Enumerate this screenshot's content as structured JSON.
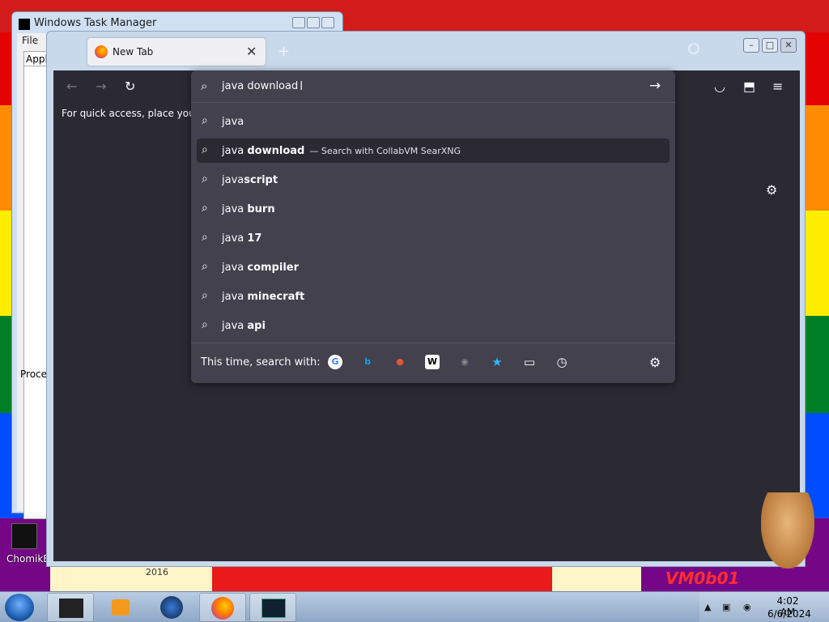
{
  "desktop": {
    "icon_label_chomik": "ChomikB",
    "year_badge": "2016",
    "vm_label": "VM0b01"
  },
  "task_manager": {
    "title": "Windows Task Manager",
    "menu_file": "File",
    "tab_applications": "Applic",
    "tab_processes": "Proces"
  },
  "browser": {
    "tab_title": "New Tab",
    "tab_close": "✕",
    "new_tab": "+",
    "bookmark_message": "For quick access, place your b",
    "url_value": "java download",
    "suggestions": [
      {
        "prefix": "java",
        "bold": "",
        "action": ""
      },
      {
        "prefix": "java ",
        "bold": "download",
        "action": "— Search with CollabVM SearXNG"
      },
      {
        "prefix": "java",
        "bold": "script",
        "action": ""
      },
      {
        "prefix": "java ",
        "bold": "burn",
        "action": ""
      },
      {
        "prefix": "java ",
        "bold": "17",
        "action": ""
      },
      {
        "prefix": "java ",
        "bold": "compiler",
        "action": ""
      },
      {
        "prefix": "java ",
        "bold": "minecraft",
        "action": ""
      },
      {
        "prefix": "java ",
        "bold": "api",
        "action": ""
      }
    ],
    "search_with_label": "This time, search with:",
    "engines": [
      {
        "name": "google-engine-icon",
        "glyph": "G",
        "color": "#4285f4"
      },
      {
        "name": "bing-engine-icon",
        "glyph": "b",
        "color": "#00a4ef"
      },
      {
        "name": "duckduckgo-engine-icon",
        "glyph": "●",
        "color": "#de5833"
      },
      {
        "name": "wikipedia-engine-icon",
        "glyph": "W",
        "color": "#000000"
      },
      {
        "name": "searxng-engine-icon",
        "glyph": "◉",
        "color": "#888888"
      },
      {
        "name": "bookmarks-icon",
        "glyph": "★",
        "color": "#2bb6ff"
      },
      {
        "name": "tabs-icon",
        "glyph": "▭",
        "color": "#fbfbfe"
      },
      {
        "name": "history-icon",
        "glyph": "◷",
        "color": "#fbfbfe"
      }
    ]
  },
  "taskbar": {
    "time": "4:02 AM",
    "date": "6/6/2024"
  },
  "colors": {
    "browser_bg": "#2b2a33",
    "dropdown_bg": "#42414d",
    "text": "#fbfbfe"
  }
}
